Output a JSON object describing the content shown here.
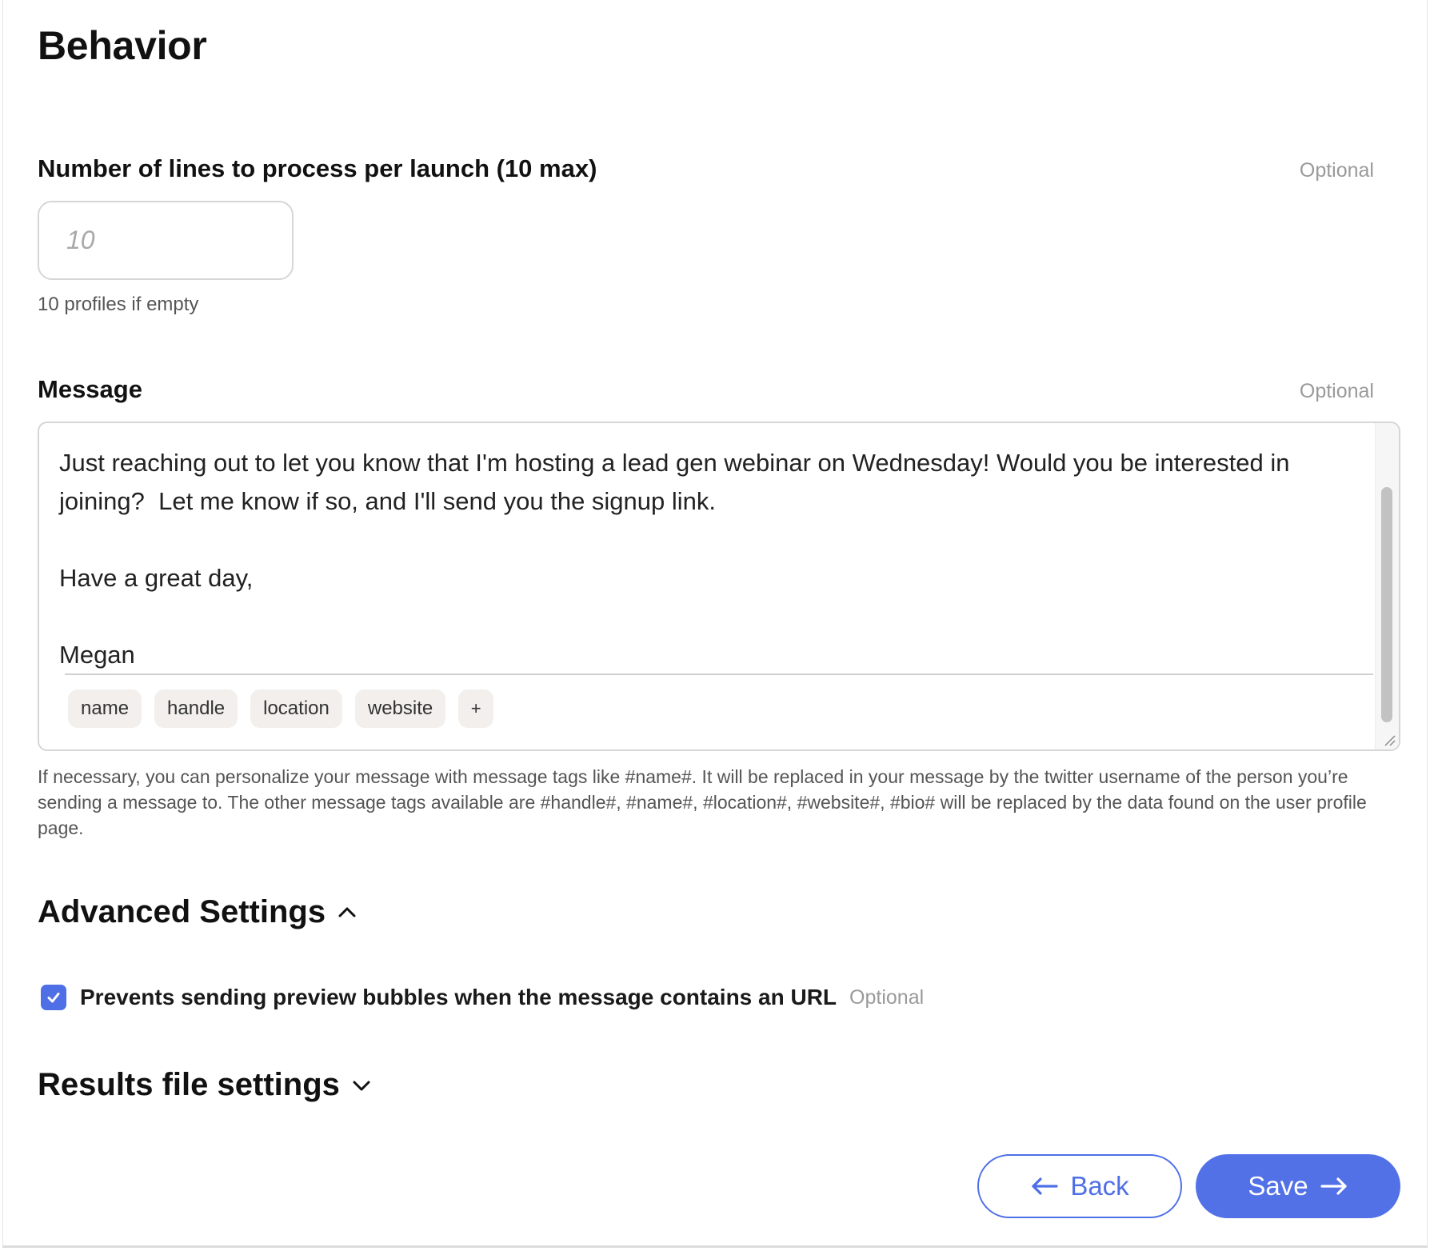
{
  "section": {
    "title": "Behavior"
  },
  "lines_field": {
    "label": "Number of lines to process per launch (10 max)",
    "optional": "Optional",
    "value": "",
    "placeholder": "10",
    "helper": "10 profiles if empty"
  },
  "message_field": {
    "label": "Message",
    "optional": "Optional",
    "text": "Just reaching out to let you know that I'm hosting a lead gen webinar on Wednesday! Would you be interested in joining?  Let me know if so, and I'll send you the signup link.\n\nHave a great day,\n\nMegan",
    "tags": [
      "name",
      "handle",
      "location",
      "website",
      "+"
    ],
    "description": "If necessary, you can personalize your message with message tags like #name#. It will be replaced in your message by the twitter username of the person you’re sending a message to. The other message tags available are #handle#, #name#, #location#, #website#, #bio# will be replaced by the data found on the user profile page."
  },
  "advanced": {
    "title": "Advanced Settings",
    "expanded": true,
    "checkbox": {
      "label": "Prevents sending preview bubbles when the message contains an URL",
      "optional": "Optional",
      "checked": true
    }
  },
  "results": {
    "title": "Results file settings",
    "expanded": false
  },
  "actions": {
    "back_label": "Back",
    "save_label": "Save"
  },
  "colors": {
    "accent": "#5271e6",
    "checkbox": "#4f6fe6",
    "tag_bg": "#f2efec"
  },
  "icons": {
    "advanced_toggle": "chevron-up-icon",
    "results_toggle": "chevron-down-icon",
    "back": "arrow-left-icon",
    "save": "arrow-right-icon",
    "checkbox": "check-icon"
  }
}
